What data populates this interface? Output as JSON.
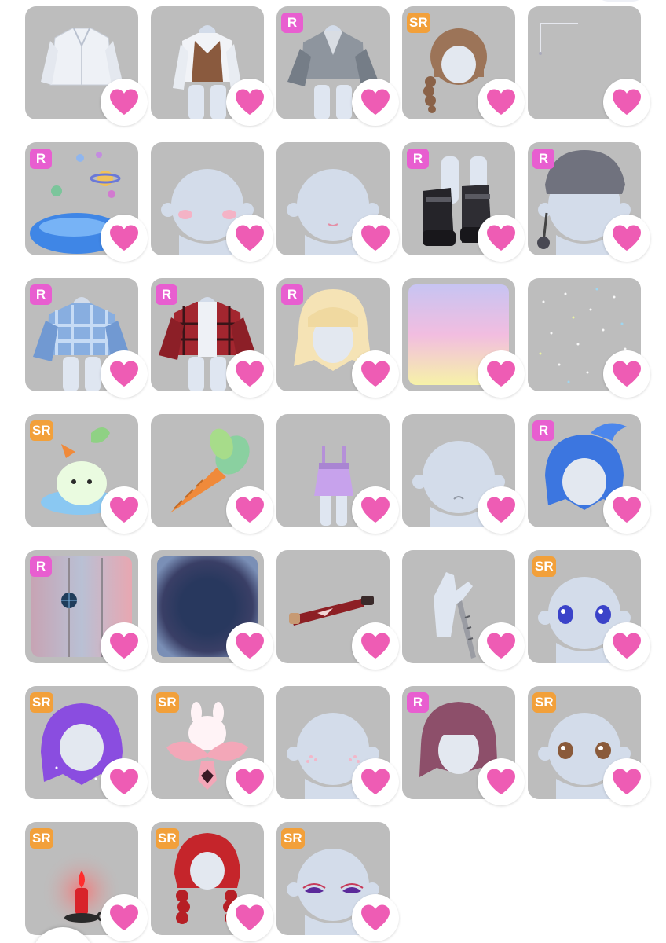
{
  "colors": {
    "tile_bg": "#bdbdbd",
    "badge_r": "#e85ed0",
    "badge_sr": "#f2a03a",
    "heart": "#ee5cb4"
  },
  "items": [
    {
      "badge": "",
      "art": "white-shirt",
      "icon": "heart-icon"
    },
    {
      "badge": "",
      "art": "brown-vest-shirt",
      "icon": "heart-icon"
    },
    {
      "badge": "R",
      "art": "grey-jacket",
      "icon": "heart-icon"
    },
    {
      "badge": "SR",
      "art": "brown-braid-hair",
      "icon": "heart-icon"
    },
    {
      "badge": "",
      "art": "sparkle-line",
      "icon": "heart-icon"
    },
    {
      "badge": "R",
      "art": "blue-blob-planets",
      "icon": "heart-icon"
    },
    {
      "badge": "",
      "art": "blush-face",
      "icon": "heart-icon"
    },
    {
      "badge": "",
      "art": "small-mouth-face",
      "icon": "heart-icon"
    },
    {
      "badge": "R",
      "art": "black-boots",
      "icon": "heart-icon"
    },
    {
      "badge": "R",
      "art": "grey-beanie",
      "icon": "heart-icon"
    },
    {
      "badge": "R",
      "art": "blue-plaid-jacket",
      "icon": "heart-icon"
    },
    {
      "badge": "R",
      "art": "red-plaid-jacket",
      "icon": "heart-icon"
    },
    {
      "badge": "R",
      "art": "blonde-hair",
      "icon": "heart-icon"
    },
    {
      "badge": "",
      "art": "pastel-gradient",
      "icon": "heart-icon"
    },
    {
      "badge": "",
      "art": "sparkle-field",
      "icon": "heart-icon"
    },
    {
      "badge": "SR",
      "art": "carrot-creature",
      "icon": "heart-icon"
    },
    {
      "badge": "",
      "art": "carrot",
      "icon": "heart-icon"
    },
    {
      "badge": "",
      "art": "purple-overall-skirt",
      "icon": "heart-icon"
    },
    {
      "badge": "",
      "art": "frown-face",
      "icon": "heart-icon"
    },
    {
      "badge": "R",
      "art": "blue-ponytail-hair",
      "icon": "heart-icon"
    },
    {
      "badge": "R",
      "art": "disco-room",
      "icon": "heart-icon"
    },
    {
      "badge": "",
      "art": "dark-vignette",
      "icon": "heart-icon"
    },
    {
      "badge": "",
      "art": "red-pipe",
      "icon": "heart-icon"
    },
    {
      "badge": "",
      "art": "glove-blade",
      "icon": "heart-icon"
    },
    {
      "badge": "SR",
      "art": "blue-eyes-face",
      "icon": "heart-icon"
    },
    {
      "badge": "SR",
      "art": "purple-galaxy-hair",
      "icon": "heart-icon"
    },
    {
      "badge": "SR",
      "art": "bunny-bow",
      "icon": "heart-icon"
    },
    {
      "badge": "",
      "art": "sparkle-cheeks-face",
      "icon": "heart-icon"
    },
    {
      "badge": "R",
      "art": "mauve-bob-hair",
      "icon": "heart-icon"
    },
    {
      "badge": "SR",
      "art": "brown-eyes-face",
      "icon": "heart-icon"
    },
    {
      "badge": "SR",
      "art": "red-candle",
      "icon": "heart-icon"
    },
    {
      "badge": "SR",
      "art": "red-braids-hair",
      "icon": "heart-icon"
    },
    {
      "badge": "SR",
      "art": "purple-eyes-face",
      "icon": "heart-icon"
    }
  ]
}
